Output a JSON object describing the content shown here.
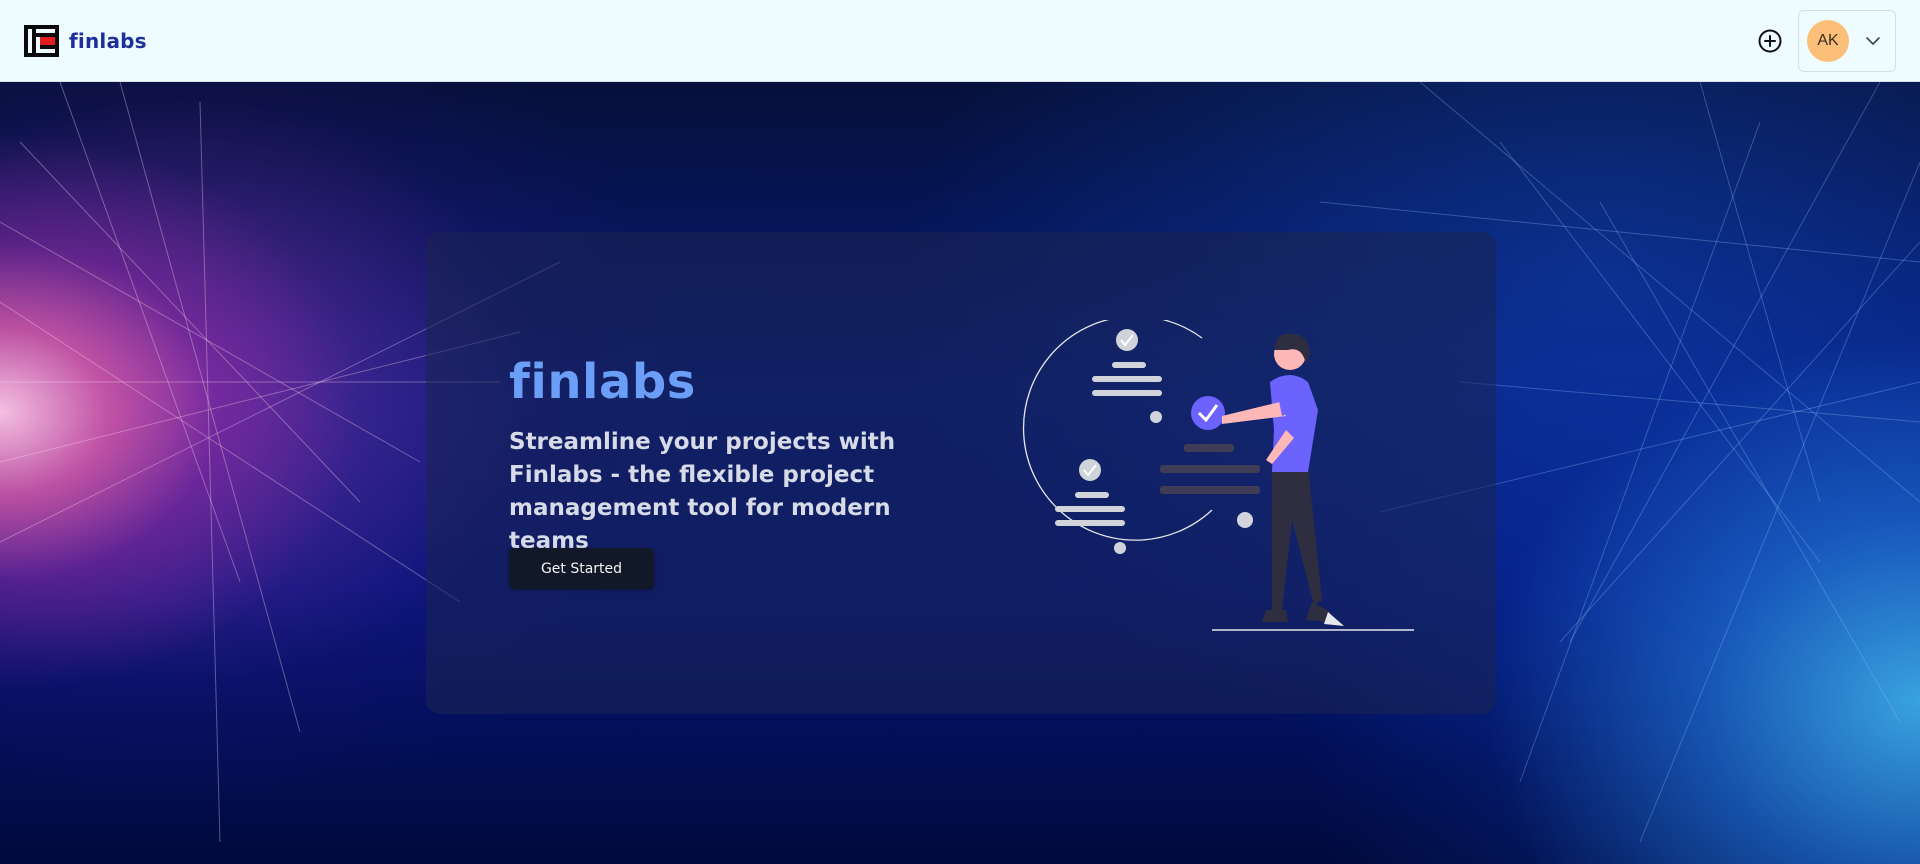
{
  "header": {
    "brand_name": "finlabs",
    "user_initials": "AK",
    "icons": [
      "finlabs-logo",
      "plus-circle-icon",
      "chevron-down-icon"
    ]
  },
  "hero": {
    "title": "finlabs",
    "tagline": "Streamline your projects with Finlabs - the flexible project management tool for modern teams",
    "cta_label": "Get Started"
  },
  "colors": {
    "header_bg": "#effcff",
    "brand_text": "#1d2f9a",
    "avatar_bg": "#fbbf7a",
    "hero_title": "#6b9ef6",
    "cta_bg": "#111827",
    "illustration_accent": "#6c63ff"
  }
}
